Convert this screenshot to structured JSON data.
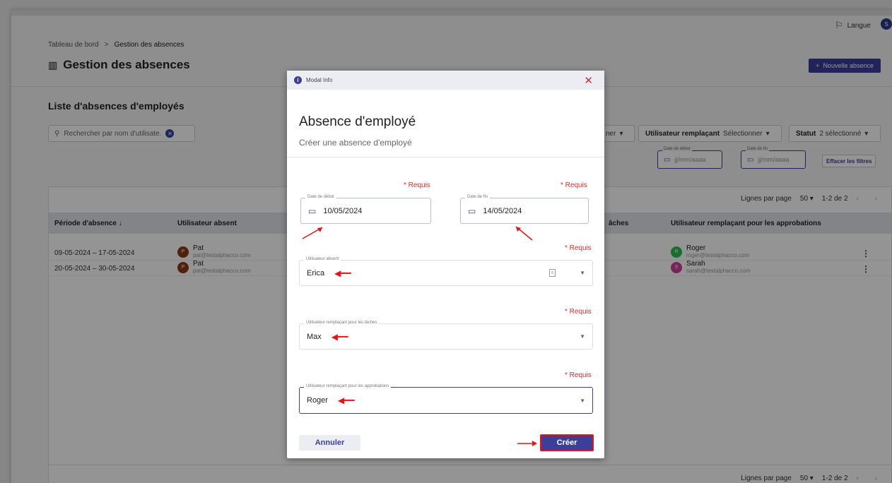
{
  "topbar": {
    "language_label": "Langue",
    "avatar_letter": "S"
  },
  "breadcrumb": {
    "root": "Tableau de bord",
    "separator": ">",
    "current": "Gestion des absences"
  },
  "page": {
    "title": "Gestion des absences",
    "new_button": "Nouvelle absence",
    "new_button_icon": "+"
  },
  "list": {
    "title": "Liste d'absences d'employés"
  },
  "search": {
    "placeholder": "Rechercher par nom d'utilisate."
  },
  "filters": {
    "partial_label": "ner",
    "replacement_label": "Utilisateur remplaçant",
    "replacement_value": "Sélectionner",
    "status_label": "Statut",
    "status_value": "2 sélectionné",
    "date_start_label": "Date de début",
    "date_start_placeholder": "jj/mm/aaaa",
    "date_end_label": "Date de fin",
    "date_end_placeholder": "jj/mm/aaaa",
    "clear_label": "Effacer les filtres"
  },
  "pager": {
    "rows_per_page_label": "Lignes par page",
    "rows_per_page": "50",
    "range": "1-2 de 2"
  },
  "table": {
    "headers": {
      "period": "Période d'absence ↓",
      "absent": "Utilisateur absent",
      "taches": "âches",
      "approbations": "Utilisateur remplaçant pour les approbations"
    },
    "rows": [
      {
        "period": "09-05-2024 – 17-05-2024",
        "absent_initial": "P",
        "absent_name": "Pat",
        "absent_email": "pat@testalphacco.com",
        "appr_initial": "R",
        "appr_name": "Roger",
        "appr_email": "roger@testalphacco.com"
      },
      {
        "period": "20-05-2024 – 30-05-2024",
        "absent_initial": "P",
        "absent_name": "Pat",
        "absent_email": "pat@testalphacco.com",
        "appr_initial": "S",
        "appr_name": "Sarah",
        "appr_email": "sarah@testalphacco.com"
      }
    ]
  },
  "modal": {
    "header_label": "Modal Info",
    "title": "Absence d'employé",
    "subtitle": "Créer une absence d'employé",
    "required_label": "* Requis",
    "start_label": "Date de début",
    "start_value": "10/05/2024",
    "end_label": "Date de fin",
    "end_value": "14/05/2024",
    "absent_label": "Utilisateur absent",
    "absent_value": "Erica",
    "taches_label": "Utilisateur remplaçant pour les tâches",
    "taches_value": "Max",
    "appr_label": "Utilisateur remplaçant pour les approbations",
    "appr_value": "Roger",
    "cancel_label": "Annuler",
    "create_label": "Créer"
  },
  "colors": {
    "primary": "#3b3f9a",
    "required": "#d32f2f",
    "annotation": "#e11111"
  },
  "icons": [
    "flag-icon",
    "building-icon",
    "search-icon",
    "clear-icon",
    "calendar-icon",
    "chevron-down-icon",
    "kebab-menu-icon",
    "info-icon",
    "close-icon",
    "list-icon"
  ]
}
